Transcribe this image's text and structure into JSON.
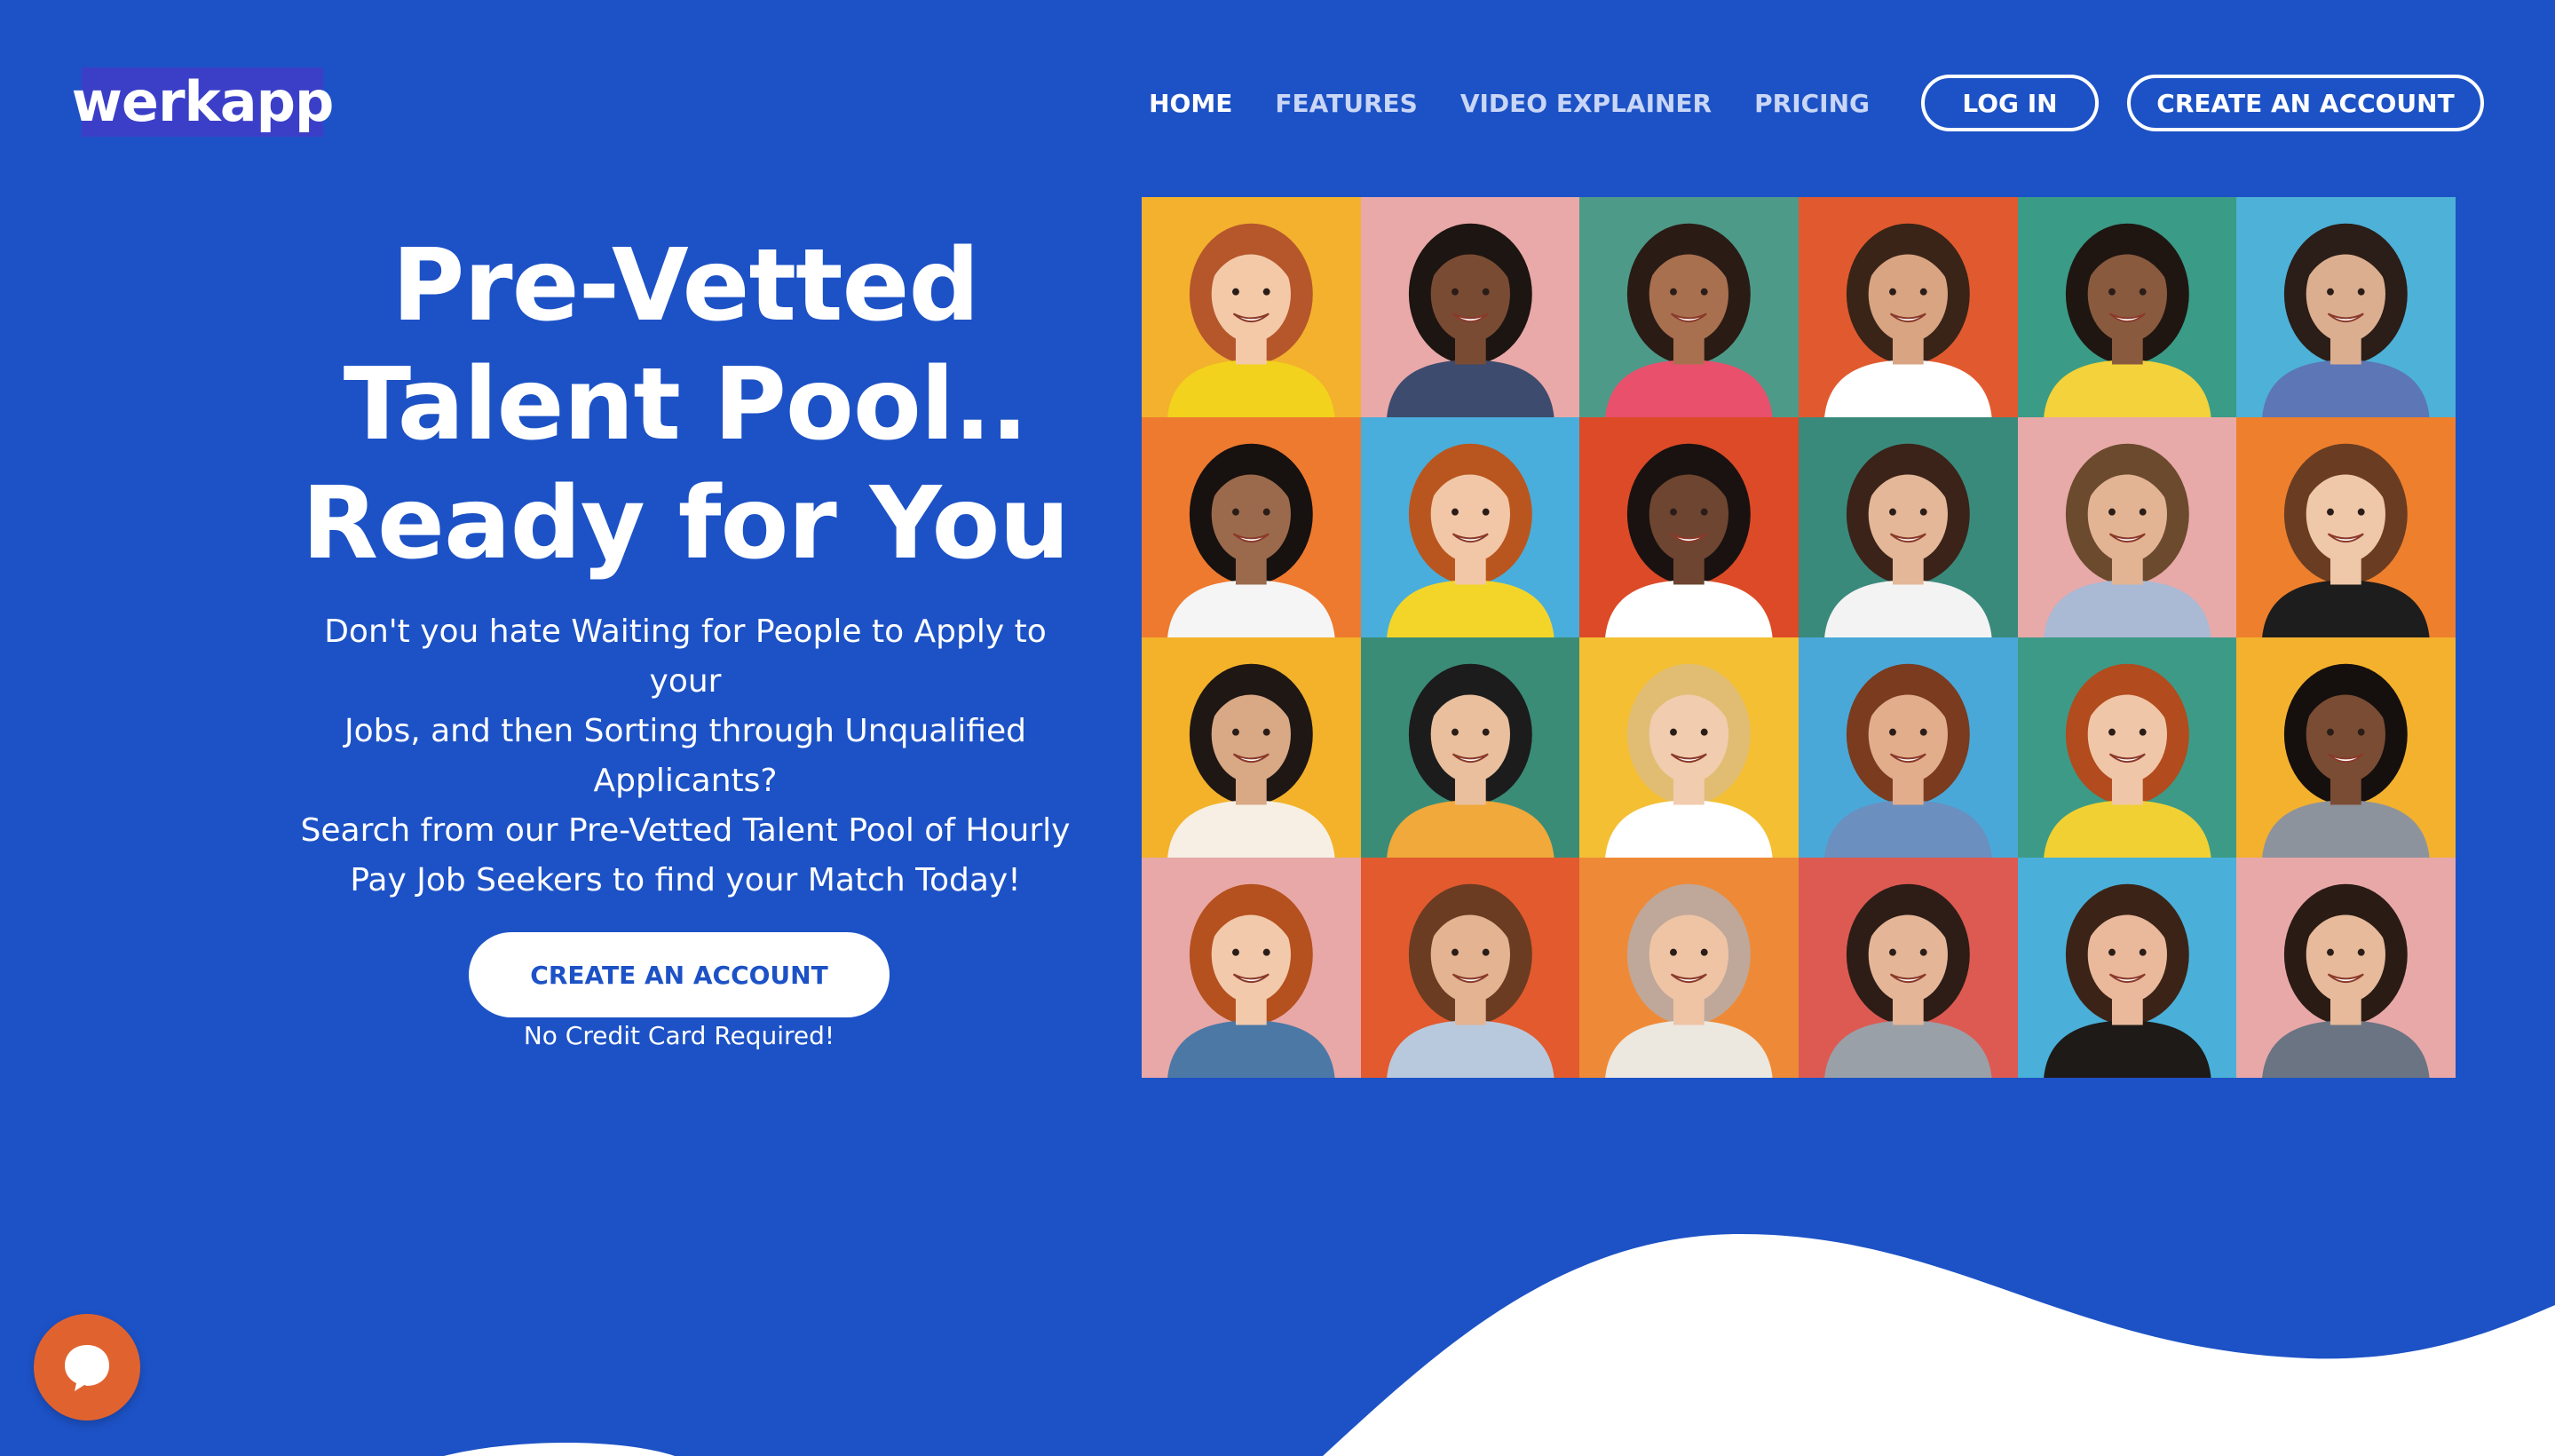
{
  "brand": {
    "logo_text": "werkapp"
  },
  "nav": {
    "links": [
      {
        "label": "HOME",
        "active": true
      },
      {
        "label": "FEATURES",
        "active": false
      },
      {
        "label": "VIDEO EXPLAINER",
        "active": false
      },
      {
        "label": "PRICING",
        "active": false
      }
    ],
    "login_label": "LOG IN",
    "create_label": "CREATE AN ACCOUNT"
  },
  "hero": {
    "title_lines": [
      "Pre-Vetted",
      "Talent Pool..",
      "Ready for You"
    ],
    "para1_lines": [
      "Don't you hate Waiting for People to Apply to your",
      "Jobs, and then Sorting through Unqualified",
      "Applicants?"
    ],
    "para2_lines": [
      "Search from our Pre-Vetted Talent Pool of Hourly",
      "Pay Job Seekers to find your Match Today!"
    ],
    "cta_label": "CREATE AN ACCOUNT",
    "cta_note": "No Credit Card Required!"
  },
  "portraits": [
    {
      "bg": "#f3b12e",
      "skin": "#f3c9a8",
      "hair": "#b5562b",
      "shirt": "#f2d21c"
    },
    {
      "bg": "#e9a9a8",
      "skin": "#7a4b33",
      "hair": "#1d1512",
      "shirt": "#3d4b6e"
    },
    {
      "bg": "#4e9a88",
      "skin": "#a8704f",
      "hair": "#2a1b15",
      "shirt": "#e8506b"
    },
    {
      "bg": "#e15a2f",
      "skin": "#d9a482",
      "hair": "#3a2418",
      "shirt": "#ffffff"
    },
    {
      "bg": "#3a9b86",
      "skin": "#8a5a3e",
      "hair": "#1f1612",
      "shirt": "#f3d23b"
    },
    {
      "bg": "#4db1d8",
      "skin": "#dcae90",
      "hair": "#2b1d17",
      "shirt": "#5d76b5"
    },
    {
      "bg": "#ee7a2f",
      "skin": "#9b6a4c",
      "hair": "#17110f",
      "shirt": "#f5f5f5"
    },
    {
      "bg": "#49aedb",
      "skin": "#f2c7a8",
      "hair": "#b9561f",
      "shirt": "#f3d52a"
    },
    {
      "bg": "#dc4a28",
      "skin": "#6e4530",
      "hair": "#1a1210",
      "shirt": "#ffffff"
    },
    {
      "bg": "#3a8a7c",
      "skin": "#e3b797",
      "hair": "#3b231a",
      "shirt": "#f3f3f3"
    },
    {
      "bg": "#e8a9a9",
      "skin": "#e2b493",
      "hair": "#6b4a2e",
      "shirt": "#aab9d4"
    },
    {
      "bg": "#ee7f2c",
      "skin": "#efc7a9",
      "hair": "#6a3d22",
      "shirt": "#1d1d1d"
    },
    {
      "bg": "#f3b22a",
      "skin": "#d9a885",
      "hair": "#1f1714",
      "shirt": "#f7efe4"
    },
    {
      "bg": "#3a8c77",
      "skin": "#e9bf9d",
      "hair": "#1c1c1c",
      "shirt": "#f0a93a"
    },
    {
      "bg": "#f4bf33",
      "skin": "#f1ccae",
      "hair": "#e1bd74",
      "shirt": "#ffffff"
    },
    {
      "bg": "#4aa8d8",
      "skin": "#e2ad8b",
      "hair": "#7a3b1f",
      "shirt": "#6b8fbe"
    },
    {
      "bg": "#3d9a87",
      "skin": "#f0c6a8",
      "hair": "#b24b1d",
      "shirt": "#f1d033"
    },
    {
      "bg": "#f3b12e",
      "skin": "#7a4c33",
      "hair": "#15100e",
      "shirt": "#8d939c"
    },
    {
      "bg": "#e8a8a7",
      "skin": "#f2c9ab",
      "hair": "#b5501f",
      "shirt": "#4c78a6"
    },
    {
      "bg": "#e25a2e",
      "skin": "#e4b392",
      "hair": "#6b3c22",
      "shirt": "#b9c9dd"
    },
    {
      "bg": "#ee8a37",
      "skin": "#eec4a5",
      "hair": "#bfa89a",
      "shirt": "#ece7df"
    },
    {
      "bg": "#dc5a52",
      "skin": "#e5b597",
      "hair": "#2d1d16",
      "shirt": "#9aa0a8"
    },
    {
      "bg": "#4ab0d9",
      "skin": "#eab99b",
      "hair": "#3b2417",
      "shirt": "#1e1a18"
    },
    {
      "bg": "#e9a8a8",
      "skin": "#e7ba9b",
      "hair": "#2a1c15",
      "shirt": "#6b7482"
    }
  ],
  "chat": {
    "icon": "chat-bubble-icon"
  },
  "colors": {
    "background": "#1d52c6",
    "logo_bg": "#3b3fc8",
    "chat_bg": "#e0632f",
    "white": "#ffffff"
  }
}
